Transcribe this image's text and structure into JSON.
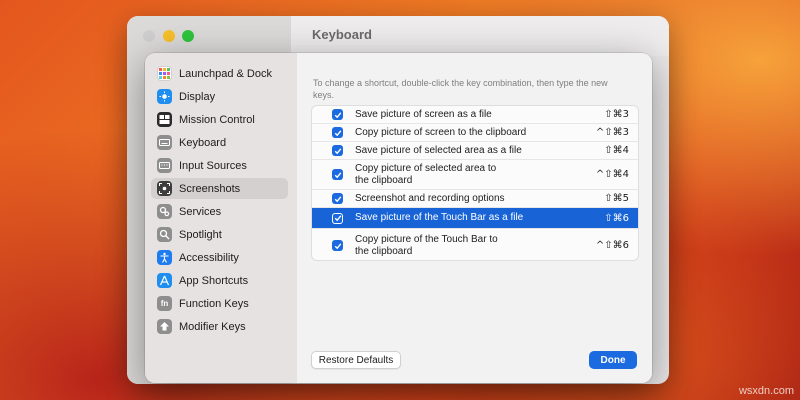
{
  "background_window": {
    "title": "Keyboard"
  },
  "sidebar": {
    "items": [
      {
        "label": "Launchpad & Dock",
        "icon": "launchpad-icon",
        "color": "#ffffff"
      },
      {
        "label": "Display",
        "icon": "display-icon",
        "color": "#1f8ef1"
      },
      {
        "label": "Mission Control",
        "icon": "mission-control-icon",
        "color": "#2b2b2b"
      },
      {
        "label": "Keyboard",
        "icon": "keyboard-icon",
        "color": "#8e8e8e"
      },
      {
        "label": "Input Sources",
        "icon": "input-sources-icon",
        "color": "#8e8e8e"
      },
      {
        "label": "Screenshots",
        "icon": "screenshots-icon",
        "color": "#3d3d3d",
        "selected": true
      },
      {
        "label": "Services",
        "icon": "services-icon",
        "color": "#8e8e8e"
      },
      {
        "label": "Spotlight",
        "icon": "spotlight-icon",
        "color": "#8e8e8e"
      },
      {
        "label": "Accessibility",
        "icon": "accessibility-icon",
        "color": "#1f7cf0"
      },
      {
        "label": "App Shortcuts",
        "icon": "app-shortcuts-icon",
        "color": "#1f8ef1"
      },
      {
        "label": "Function Keys",
        "icon": "function-keys-icon",
        "color": "#8e8e8e"
      },
      {
        "label": "Modifier Keys",
        "icon": "modifier-keys-icon",
        "color": "#8e8e8e"
      }
    ]
  },
  "main": {
    "hint": "To change a shortcut, double-click the key combination, then type the new keys.",
    "shortcuts": [
      {
        "label": "Save picture of screen as a file",
        "keys": "⇧⌘3",
        "checked": true
      },
      {
        "label": "Copy picture of screen to the clipboard",
        "keys": "^⇧⌘3",
        "checked": true
      },
      {
        "label": "Save picture of selected area as a file",
        "keys": "⇧⌘4",
        "checked": true
      },
      {
        "label": "Copy picture of selected area to\nthe clipboard",
        "keys": "^⇧⌘4",
        "checked": true
      },
      {
        "label": "Screenshot and recording options",
        "keys": "⇧⌘5",
        "checked": true
      },
      {
        "label": "Save picture of the Touch Bar as a file",
        "keys": "⇧⌘6",
        "checked": true,
        "selected": true
      },
      {
        "label": "Copy picture of the Touch Bar to\nthe clipboard",
        "keys": "^⇧⌘6",
        "checked": true
      }
    ],
    "restore_label": "Restore Defaults",
    "done_label": "Done"
  },
  "watermark": "wsxdn.com",
  "colors": {
    "accent": "#1b6ae0",
    "selection": "#1863d6"
  }
}
